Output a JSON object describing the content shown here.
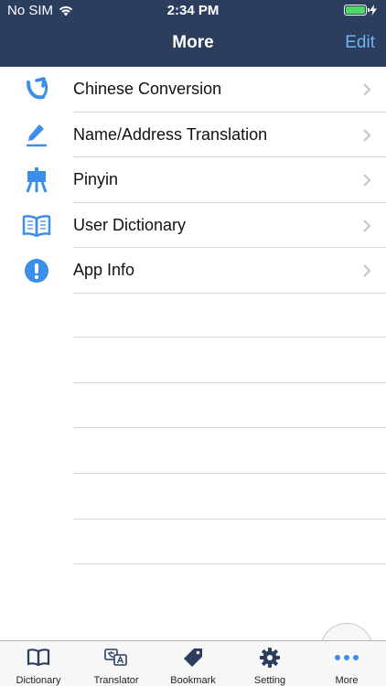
{
  "status": {
    "carrier": "No SIM",
    "time": "2:34 PM"
  },
  "nav": {
    "title": "More",
    "edit_label": "Edit"
  },
  "menu": {
    "items": [
      {
        "label": "Chinese Conversion",
        "icon": "conversion-arrow-icon"
      },
      {
        "label": "Name/Address Translation",
        "icon": "pencil-icon"
      },
      {
        "label": "Pinyin",
        "icon": "easel-icon"
      },
      {
        "label": "User Dictionary",
        "icon": "open-book-icon"
      },
      {
        "label": "App Info",
        "icon": "info-exclamation-icon"
      }
    ]
  },
  "tabs": [
    {
      "label": "Dictionary",
      "icon": "book-icon"
    },
    {
      "label": "Translator",
      "icon": "translate-icon"
    },
    {
      "label": "Bookmark",
      "icon": "tag-icon"
    },
    {
      "label": "Setting",
      "icon": "gear-icon"
    },
    {
      "label": "More",
      "icon": "ellipsis-icon",
      "active": true
    }
  ],
  "colors": {
    "header": "#2c3e5e",
    "accent": "#3b8eea",
    "edit": "#6fb3f5",
    "battery": "#4cd964"
  }
}
